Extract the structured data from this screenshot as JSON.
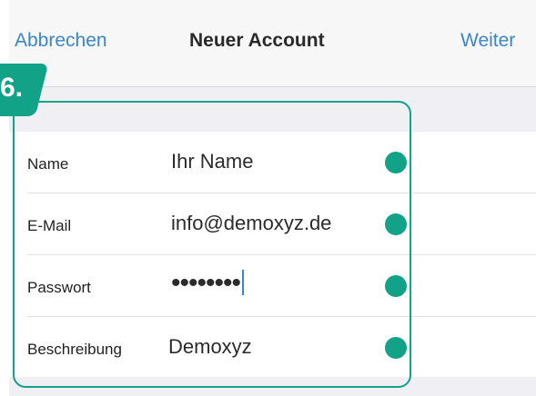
{
  "navbar": {
    "cancel_label": "Abbrechen",
    "title": "Neuer Account",
    "next_label": "Weiter"
  },
  "step": {
    "label": "6."
  },
  "form": {
    "rows": [
      {
        "label": "Name",
        "value": "Ihr Name"
      },
      {
        "label": "E-Mail",
        "value": "info@demoxyz.de"
      },
      {
        "label": "Passwort",
        "value": "••••••••"
      },
      {
        "label": "Beschreibung",
        "value": "Demoxyz"
      }
    ]
  },
  "colors": {
    "accent": "#12a288",
    "link": "#3a86c8",
    "grouped_background": "#efeff4"
  }
}
